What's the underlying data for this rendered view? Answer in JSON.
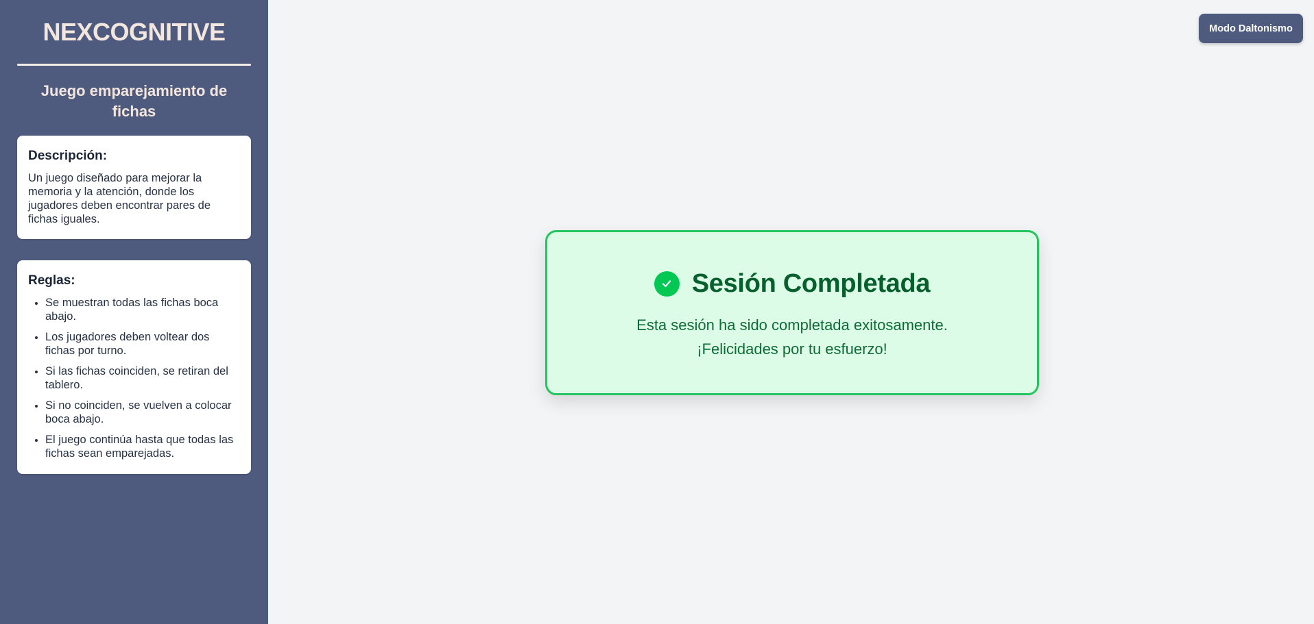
{
  "sidebar": {
    "brand": "NEXCOGNITIVE",
    "game_title": "Juego emparejamiento de fichas",
    "description": {
      "heading": "Descripción:",
      "text": "Un juego diseñado para mejorar la memoria y la atención, donde los jugadores deben encontrar pares de fichas iguales."
    },
    "rules": {
      "heading": "Reglas:",
      "items": [
        "Se muestran todas las fichas boca abajo.",
        "Los jugadores deben voltear dos fichas por turno.",
        "Si las fichas coinciden, se retiran del tablero.",
        "Si no coinciden, se vuelven a colocar boca abajo.",
        "El juego continúa hasta que todas las fichas sean emparejadas."
      ]
    }
  },
  "header": {
    "mode_button": "Modo Daltonismo"
  },
  "completion": {
    "icon": "check-circle-icon",
    "title": "Sesión Completada",
    "line1": "Esta sesión ha sido completada exitosamente.",
    "line2": "¡Felicidades por tu esfuerzo!"
  },
  "colors": {
    "sidebar_bg": "#4e5b7e",
    "success_bg": "#dcfce7",
    "success_border": "#22c55e",
    "success_text": "#065f2c",
    "check_green": "#00c853"
  }
}
